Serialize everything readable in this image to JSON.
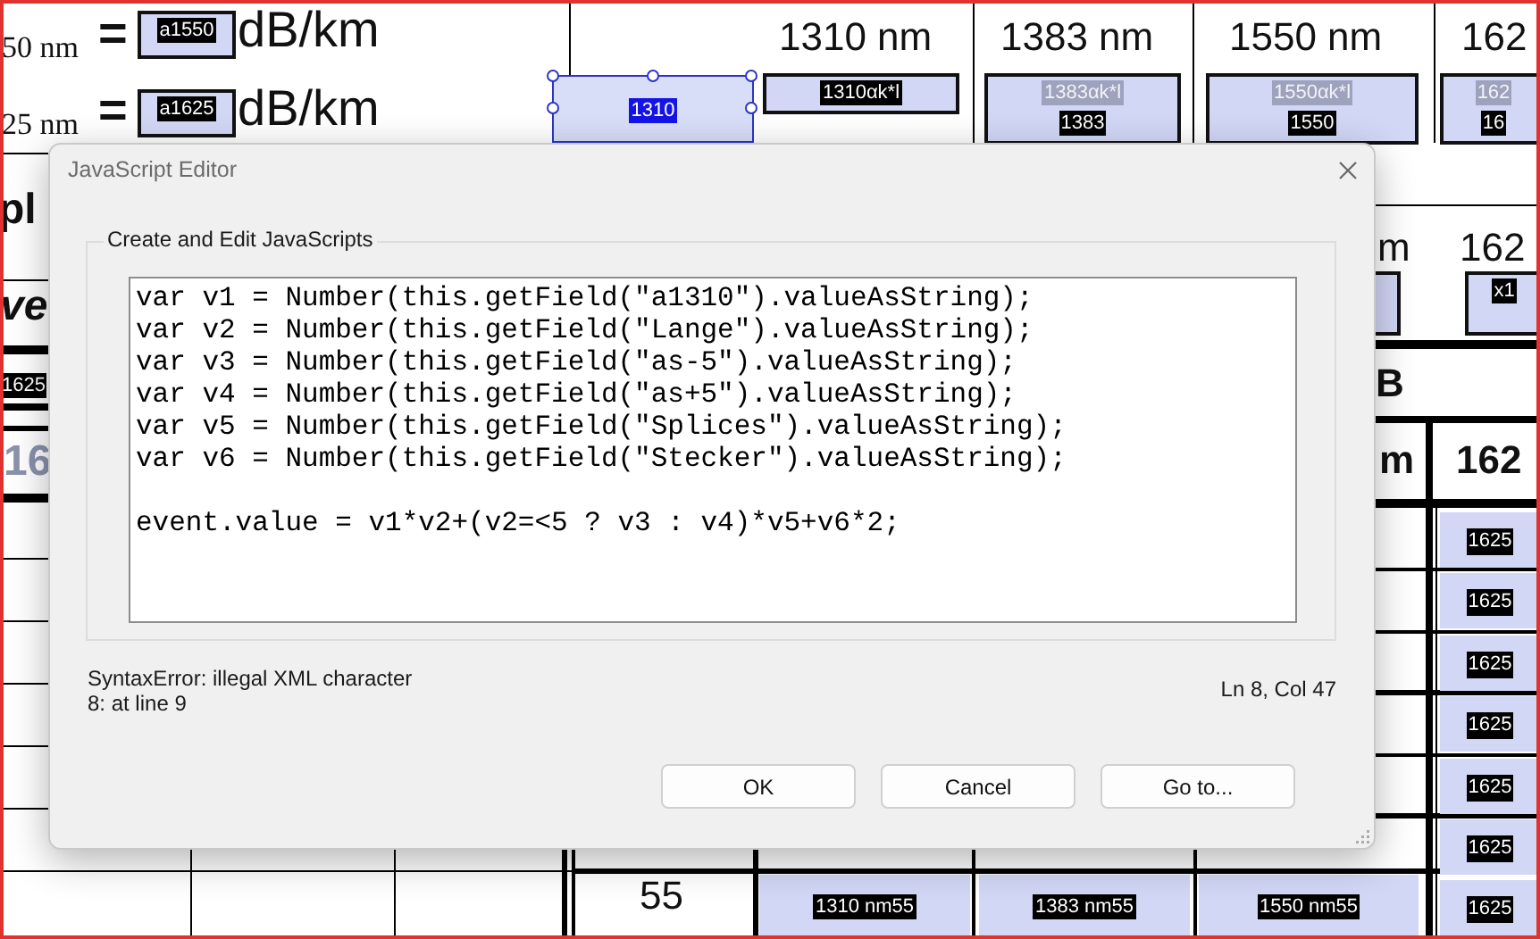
{
  "document": {
    "items": [
      {
        "kind": "label",
        "text": "50 nm"
      },
      {
        "kind": "strong",
        "text": "="
      },
      {
        "kind": "field",
        "selected": false,
        "tags": [
          {
            "text": "a1550",
            "dim": false
          }
        ]
      },
      {
        "kind": "label",
        "text": "dB/km"
      },
      {
        "kind": "label",
        "text": "25 nm"
      },
      {
        "kind": "strong",
        "text": "="
      },
      {
        "kind": "field",
        "selected": false,
        "tags": [
          {
            "text": "a1625",
            "dim": false
          }
        ]
      },
      {
        "kind": "label",
        "text": "dB/km"
      },
      {
        "kind": "label",
        "text": "1310 nm"
      },
      {
        "kind": "label",
        "text": "1383 nm"
      },
      {
        "kind": "label",
        "text": "1550 nm"
      },
      {
        "kind": "label",
        "text": "162"
      },
      {
        "kind": "field",
        "selected": true,
        "tags": [
          {
            "text": "1310",
            "dim": false
          }
        ]
      },
      {
        "kind": "field",
        "selected": false,
        "tags": [
          {
            "text": "1310αk*l",
            "dim": false
          }
        ]
      },
      {
        "kind": "field",
        "selected": false,
        "tags": [
          {
            "text": "1383αk*l",
            "dim": true
          },
          {
            "text": "1383",
            "dim": false
          }
        ]
      },
      {
        "kind": "field",
        "selected": false,
        "tags": [
          {
            "text": "1550αk*l",
            "dim": true
          },
          {
            "text": "1550",
            "dim": false
          }
        ]
      },
      {
        "kind": "field",
        "selected": false,
        "tags": [
          {
            "text": "162",
            "dim": true
          },
          {
            "text": "16",
            "dim": false
          }
        ]
      },
      {
        "kind": "strong",
        "text": "pl"
      },
      {
        "kind": "emphasis",
        "text": "ve"
      },
      {
        "kind": "tag",
        "text": "1625"
      },
      {
        "kind": "faded",
        "text": "16"
      },
      {
        "kind": "label",
        "text": "m"
      },
      {
        "kind": "label",
        "text": "162"
      },
      {
        "kind": "field",
        "selected": false
      },
      {
        "kind": "field",
        "selected": false,
        "tags": [
          {
            "text": "x1",
            "dim": false
          }
        ]
      },
      {
        "kind": "strong",
        "text": "B"
      },
      {
        "kind": "strong",
        "text": "m"
      },
      {
        "kind": "strong",
        "text": "162"
      },
      {
        "kind": "field",
        "selected": false,
        "tags": [
          {
            "text": "1625",
            "dim": false
          }
        ]
      },
      {
        "kind": "field",
        "selected": false,
        "tags": [
          {
            "text": "1625",
            "dim": false
          }
        ]
      },
      {
        "kind": "field",
        "selected": false,
        "tags": [
          {
            "text": "1625",
            "dim": false
          }
        ]
      },
      {
        "kind": "field",
        "selected": false,
        "tags": [
          {
            "text": "1625",
            "dim": false
          }
        ]
      },
      {
        "kind": "field",
        "selected": false,
        "tags": [
          {
            "text": "1625",
            "dim": false
          }
        ]
      },
      {
        "kind": "field",
        "selected": false,
        "tags": [
          {
            "text": "1625",
            "dim": false
          }
        ]
      },
      {
        "kind": "label",
        "text": "55"
      },
      {
        "kind": "field",
        "selected": false,
        "tags": [
          {
            "text": "1310 nm55",
            "dim": false
          }
        ]
      },
      {
        "kind": "field",
        "selected": false,
        "tags": [
          {
            "text": "1383 nm55",
            "dim": false
          }
        ]
      },
      {
        "kind": "field",
        "selected": false,
        "tags": [
          {
            "text": "1550 nm55",
            "dim": false
          }
        ]
      },
      {
        "kind": "field",
        "selected": false,
        "tags": [
          {
            "text": "1625",
            "dim": false
          }
        ]
      }
    ]
  },
  "dialog": {
    "title": "JavaScript Editor",
    "group_label": "Create and Edit JavaScripts",
    "code": "var v1 = Number(this.getField(\"a1310\").valueAsString);\nvar v2 = Number(this.getField(\"Lange\").valueAsString);\nvar v3 = Number(this.getField(\"as-5\").valueAsString);\nvar v4 = Number(this.getField(\"as+5\").valueAsString);\nvar v5 = Number(this.getField(\"Splices\").valueAsString);\nvar v6 = Number(this.getField(\"Stecker\").valueAsString);\n\nevent.value = v1*v2+(v2=<5 ? v3 : v4)*v5+v6*2;",
    "error": "SyntaxError: illegal XML character\n8: at line 9",
    "cursor": "Ln 8, Col 47",
    "buttons": [
      "OK",
      "Cancel",
      "Go to..."
    ]
  }
}
